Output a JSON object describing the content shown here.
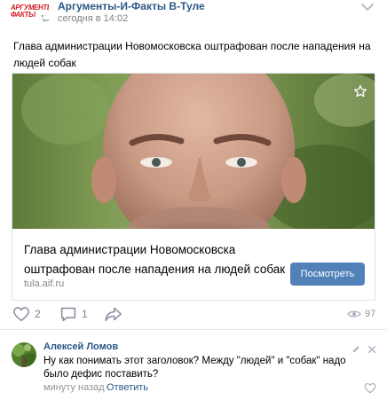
{
  "header": {
    "logo_line1": "АРГУМЕНТЫ",
    "logo_line2": "ФАКТЫ",
    "logo_sub": "в Туле",
    "group_name": "Аргументы-И-Факты В-Туле",
    "time": "сегодня в 14:02",
    "more_icon": "more-icon"
  },
  "post": {
    "text": "Глава администрации Новомосковска оштрафован после нападения на людей собак"
  },
  "link_card": {
    "title": "Глава администрации Новомосковска оштрафован после нападения на людей собак",
    "domain": "tula.aif.ru",
    "button_label": "Посмотреть",
    "bookmark_icon": "star-icon"
  },
  "actions": {
    "likes": "2",
    "comments": "1",
    "views": "97"
  },
  "comment": {
    "author": "Алексей Ломов",
    "text": "Ну как понимать этот заголовок? Между \"людей\" и \"собак\" надо было дефис поставить?",
    "time": "минуту назад",
    "reply_label": "Ответить"
  },
  "colors": {
    "link": "#2a5885",
    "button": "#5181b8",
    "muted": "#828282"
  }
}
